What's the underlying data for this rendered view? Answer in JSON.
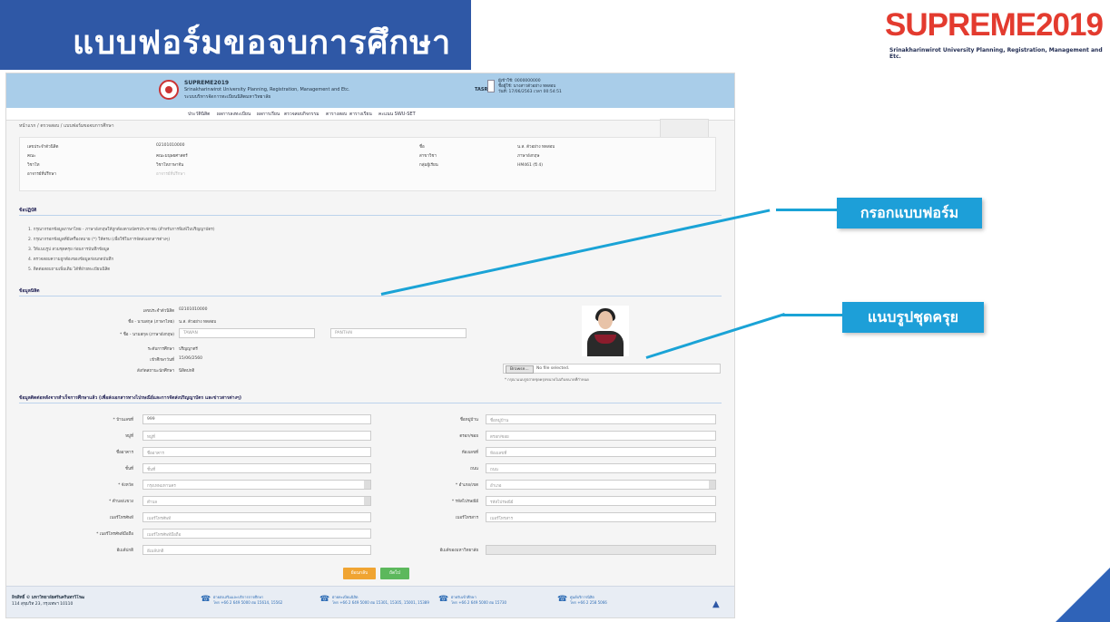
{
  "slide": {
    "title": "แบบฟอร์มขอจบการศึกษา",
    "brand": "SUPREME2019",
    "brand_subtitle": "Srinakharinwirot University Planning, Registration, Management and Etc."
  },
  "site": {
    "name": "SUPREME2019",
    "line2": "Srinakharinwirot University Planning, Registration, Management and Etc.",
    "line3": "ระบบบริหารจัดการทะเบียนนิสิตมหาวิทยาลัย",
    "user_tag": "TASR",
    "user_line1": "ผู้เข้าใช้: 0000000000",
    "user_line2": "ชื่อผู้ใช้: นางสาวตัวอย่าง ทดสอบ",
    "user_line3": "วันที่: 17/06/2563 เวลา 00:54:51"
  },
  "nav": {
    "items": [
      "ประวัตินิสิต",
      "ผลการลงทะเบียน",
      "ผลการเรียน",
      "ตรวจสอบกิจกรรม",
      "ตารางสอบ",
      "ตารางเรียน",
      "คะแนน SWU-SET"
    ]
  },
  "breadcrumb": "หน้าแรก / ตรวจสอบ / แบบฟอร์มขอจบการศึกษา",
  "student_info": {
    "rows": [
      [
        "เลขประจำตัวนิสิต",
        "02101010000",
        "ชื่อ",
        "น.ส. ตัวอย่าง ทดสอบ"
      ],
      [
        "คณะ",
        "คณะมนุษยศาสตร์",
        "สาขาวิชา",
        "ภาษาอังกฤษ"
      ],
      [
        "วิชาโท",
        "วิชาโทภาษาจีน",
        "กลุ่มผู้เรียน",
        "HM461 (ปี 4)"
      ],
      [
        "อาจารย์ที่ปรึกษา",
        "อาจารย์ที่ปรึกษา",
        "",
        ""
      ]
    ]
  },
  "rules": {
    "title": "ข้อปฏิบัติ",
    "items": [
      "1. กรุณากรอกข้อมูลภาษาไทย - ภาษาอังกฤษให้ถูกต้องตามบัตรประชาชน (สำหรับการพิมพ์ใบปริญญาบัตร)",
      "2. กรุณากรอกข้อมูลที่มีเครื่องหมาย (*) ให้ครบ (เพื่อใช้ในการจัดส่งเอกสารต่างๆ)",
      "3. ให้แนบรูป สวมชุดครุย ก่อนการบันทึกข้อมูล",
      "4. ตรวจสอบความถูกต้องของข้อมูลก่อนกดบันทึก",
      "5. ติดต่อสอบถามเพิ่มเติม ได้ที่ฝ่ายทะเบียนนิสิต"
    ]
  },
  "student_data": {
    "title": "ข้อมูลนิสิต",
    "fields": [
      {
        "label": "เลขประจำตัวนิสิต",
        "value": "02101010000"
      },
      {
        "label": "ชื่อ - นามสกุล (ภาษาไทย)",
        "value": "น.ส. ตัวอย่าง ทดสอบ"
      },
      {
        "label": "* ชื่อ - นามสกุล (ภาษาอังกฤษ)",
        "value": "TAWAN",
        "value2": "PANTHAI"
      },
      {
        "label": "ระดับการศึกษา",
        "value": "ปริญญาตรี"
      },
      {
        "label": "เข้าศึกษาวันที่",
        "value": "15/06/2560"
      },
      {
        "label": "สังกัดสถานะนักศึกษา",
        "value": "นิสิตปกติ"
      }
    ],
    "browse_label": "Browse...",
    "browse_text": "No file selected.",
    "photo_note": "* กรุณาแนบรูปถ่ายชุดครุยขนาดไม่เกินขนาดที่กำหนด"
  },
  "address": {
    "title": "ข้อมูลติดต่อหลังจากสำเร็จการศึกษาแล้ว (เพื่อส่งเอกสารทางไปรษณีย์และการจัดส่งปริญญาบัตร และข่าวสารต่างๆ)",
    "left": [
      {
        "label": "* บ้านเลขที่",
        "value": "999"
      },
      {
        "label": "หมู่ที่",
        "value": "หมู่ที่"
      },
      {
        "label": "ชื่ออาคาร",
        "value": "ชื่ออาคาร"
      },
      {
        "label": "ชั้นที่",
        "value": "ชั้นที่"
      },
      {
        "label": "* จังหวัด",
        "value": "กรุงเทพมหานคร"
      },
      {
        "label": "* ตำบล/แขวง",
        "value": "ตำบล"
      },
      {
        "label": "เบอร์โทรศัพท์",
        "value": "เบอร์โทรศัพท์"
      },
      {
        "label": "* เบอร์โทรศัพท์มือถือ",
        "value": "เบอร์โทรศัพท์มือถือ"
      },
      {
        "label": "อีเมล์ปกติ",
        "value": "อีเมล์ปกติ"
      }
    ],
    "right": [
      {
        "label": "ชื่อหมู่บ้าน",
        "value": "ชื่อหมู่บ้าน"
      },
      {
        "label": "ตรอก/ซอย",
        "value": "ตรอก/ซอย"
      },
      {
        "label": "ห้องเลขที่",
        "value": "ห้องเลขที่"
      },
      {
        "label": "ถนน",
        "value": "ถนน"
      },
      {
        "label": "* อำเภอ/เขต",
        "value": "อำเภอ"
      },
      {
        "label": "* รหัสไปรษณีย์",
        "value": "รหัสไปรษณีย์"
      },
      {
        "label": "เบอร์โทรสาร",
        "value": "เบอร์โทรสาร"
      },
      {
        "label": "",
        "value": ""
      },
      {
        "label": "อีเมล์ของมหาวิทยาลัย",
        "value": ""
      }
    ]
  },
  "buttons": {
    "back": "ย้อนกลับ",
    "next": "ถัดไป"
  },
  "footer": {
    "brand": "ลิขสิทธิ์ © มหาวิทยาลัยศรีนครินทรวิโรฒ",
    "address": "114 สุขุมวิท 23, กรุงเทพฯ 10110",
    "contacts": [
      {
        "t1": "ฝ่ายส่งเสริมและบริการการศึกษา",
        "t2": "โทร +66 2 649 5000 ต่อ 15614, 15562"
      },
      {
        "t1": "ฝ่ายทะเบียนนิสิต",
        "t2": "โทร +66 2 649 5000 ต่อ 15301, 15305, 15001, 15389"
      },
      {
        "t1": "ฝ่ายรับเข้าศึกษา",
        "t2": "โทร +66 2 649 5000 ต่อ 15730"
      },
      {
        "t1": "ศูนย์บริการนิสิต",
        "t2": "โทร +66 2 258 5066"
      }
    ]
  },
  "callouts": {
    "fill_form": "กรอกแบบฟอร์ม",
    "attach_photo": "แนบรูปชุดครุย"
  },
  "colors": {
    "title_bar": "#2f58a6",
    "brand_red": "#e33b2f",
    "callout": "#1d9fd8"
  }
}
